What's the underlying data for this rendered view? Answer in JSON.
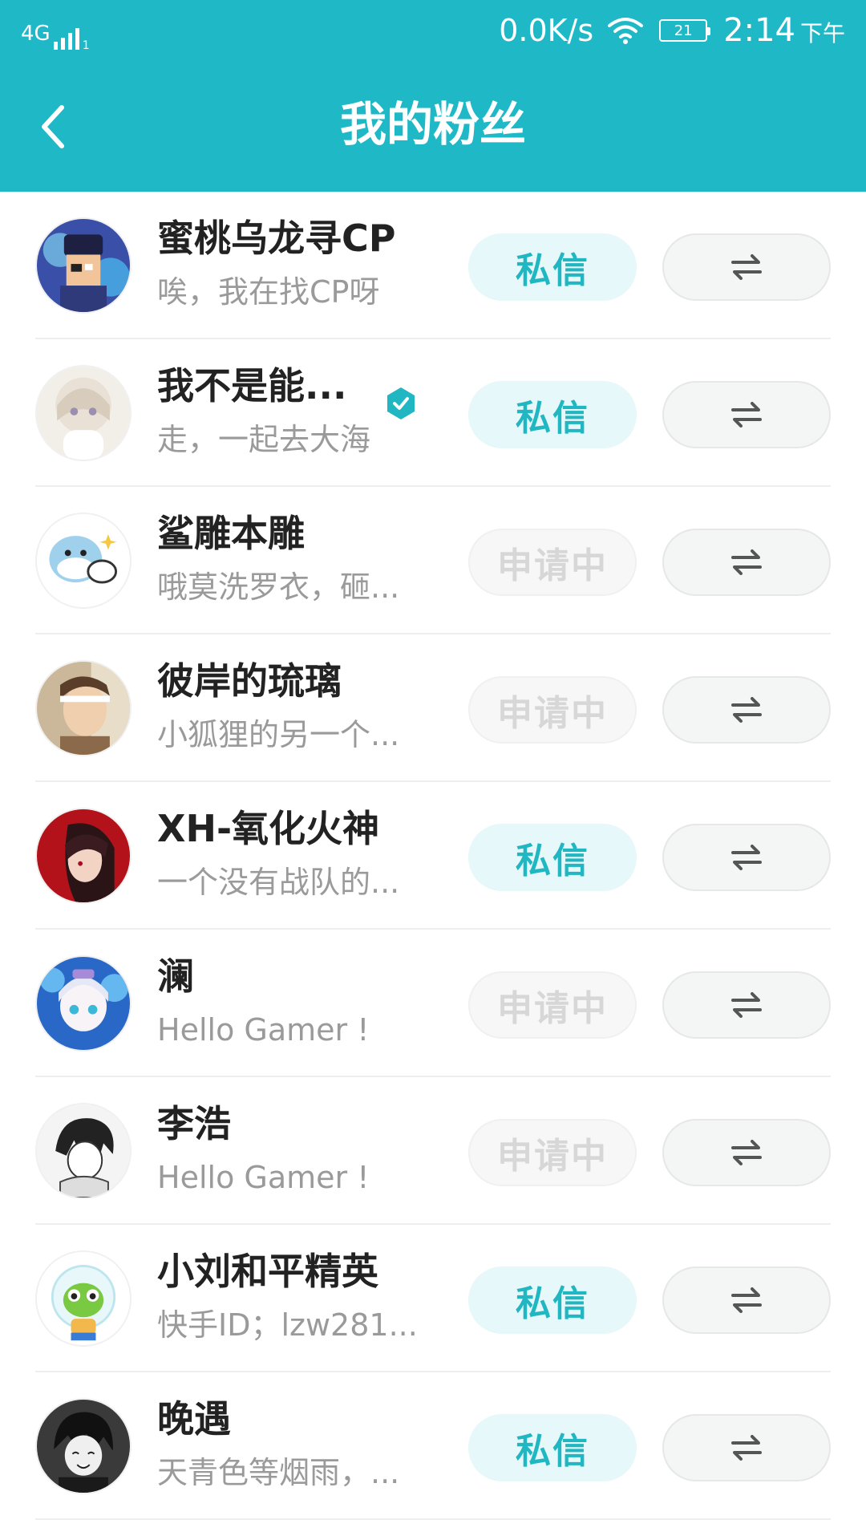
{
  "status_bar": {
    "network": "4G",
    "sim_slot": "1",
    "speed": "0.0K/s",
    "battery": "21",
    "time": "2:14",
    "ampm": "下午"
  },
  "header": {
    "title": "我的粉丝",
    "back_icon": "chevron-left-icon"
  },
  "colors": {
    "header_bg": "#1fb8c7",
    "accent": "#20b6c2",
    "message_btn_bg": "#e6f8f9",
    "pending_text": "#d7d7d7"
  },
  "fans": [
    {
      "name": "蜜桃乌龙寻CP",
      "bio": "唉，我在找CP呀",
      "action": "私信",
      "state": "message",
      "verified": false,
      "mutual_icon": "swap-arrows-icon"
    },
    {
      "name": "我不是能...",
      "bio": "走，一起去大海",
      "action": "私信",
      "state": "message",
      "verified": true,
      "mutual_icon": "swap-arrows-icon"
    },
    {
      "name": "鲨雕本雕",
      "bio": "哦莫洗罗衣，砸...",
      "action": "申请中",
      "state": "pending",
      "verified": false,
      "mutual_icon": "swap-arrows-icon"
    },
    {
      "name": "彼岸的琉璃",
      "bio": "小狐狸的另一个...",
      "action": "申请中",
      "state": "pending",
      "verified": false,
      "mutual_icon": "swap-arrows-icon"
    },
    {
      "name": "XH-氧化火神",
      "bio": "一个没有战队的...",
      "action": "私信",
      "state": "message",
      "verified": false,
      "mutual_icon": "swap-arrows-icon"
    },
    {
      "name": "澜",
      "bio": "Hello Gamer !",
      "action": "申请中",
      "state": "pending",
      "verified": false,
      "mutual_icon": "swap-arrows-icon"
    },
    {
      "name": "李浩",
      "bio": "Hello Gamer !",
      "action": "申请中",
      "state": "pending",
      "verified": false,
      "mutual_icon": "swap-arrows-icon"
    },
    {
      "name": "小刘和平精英",
      "bio": "快手ID；lzw281...",
      "action": "私信",
      "state": "message",
      "verified": false,
      "mutual_icon": "swap-arrows-icon"
    },
    {
      "name": "晚遇",
      "bio": "天青色等烟雨，...",
      "action": "私信",
      "state": "message",
      "verified": false,
      "mutual_icon": "swap-arrows-icon"
    }
  ]
}
